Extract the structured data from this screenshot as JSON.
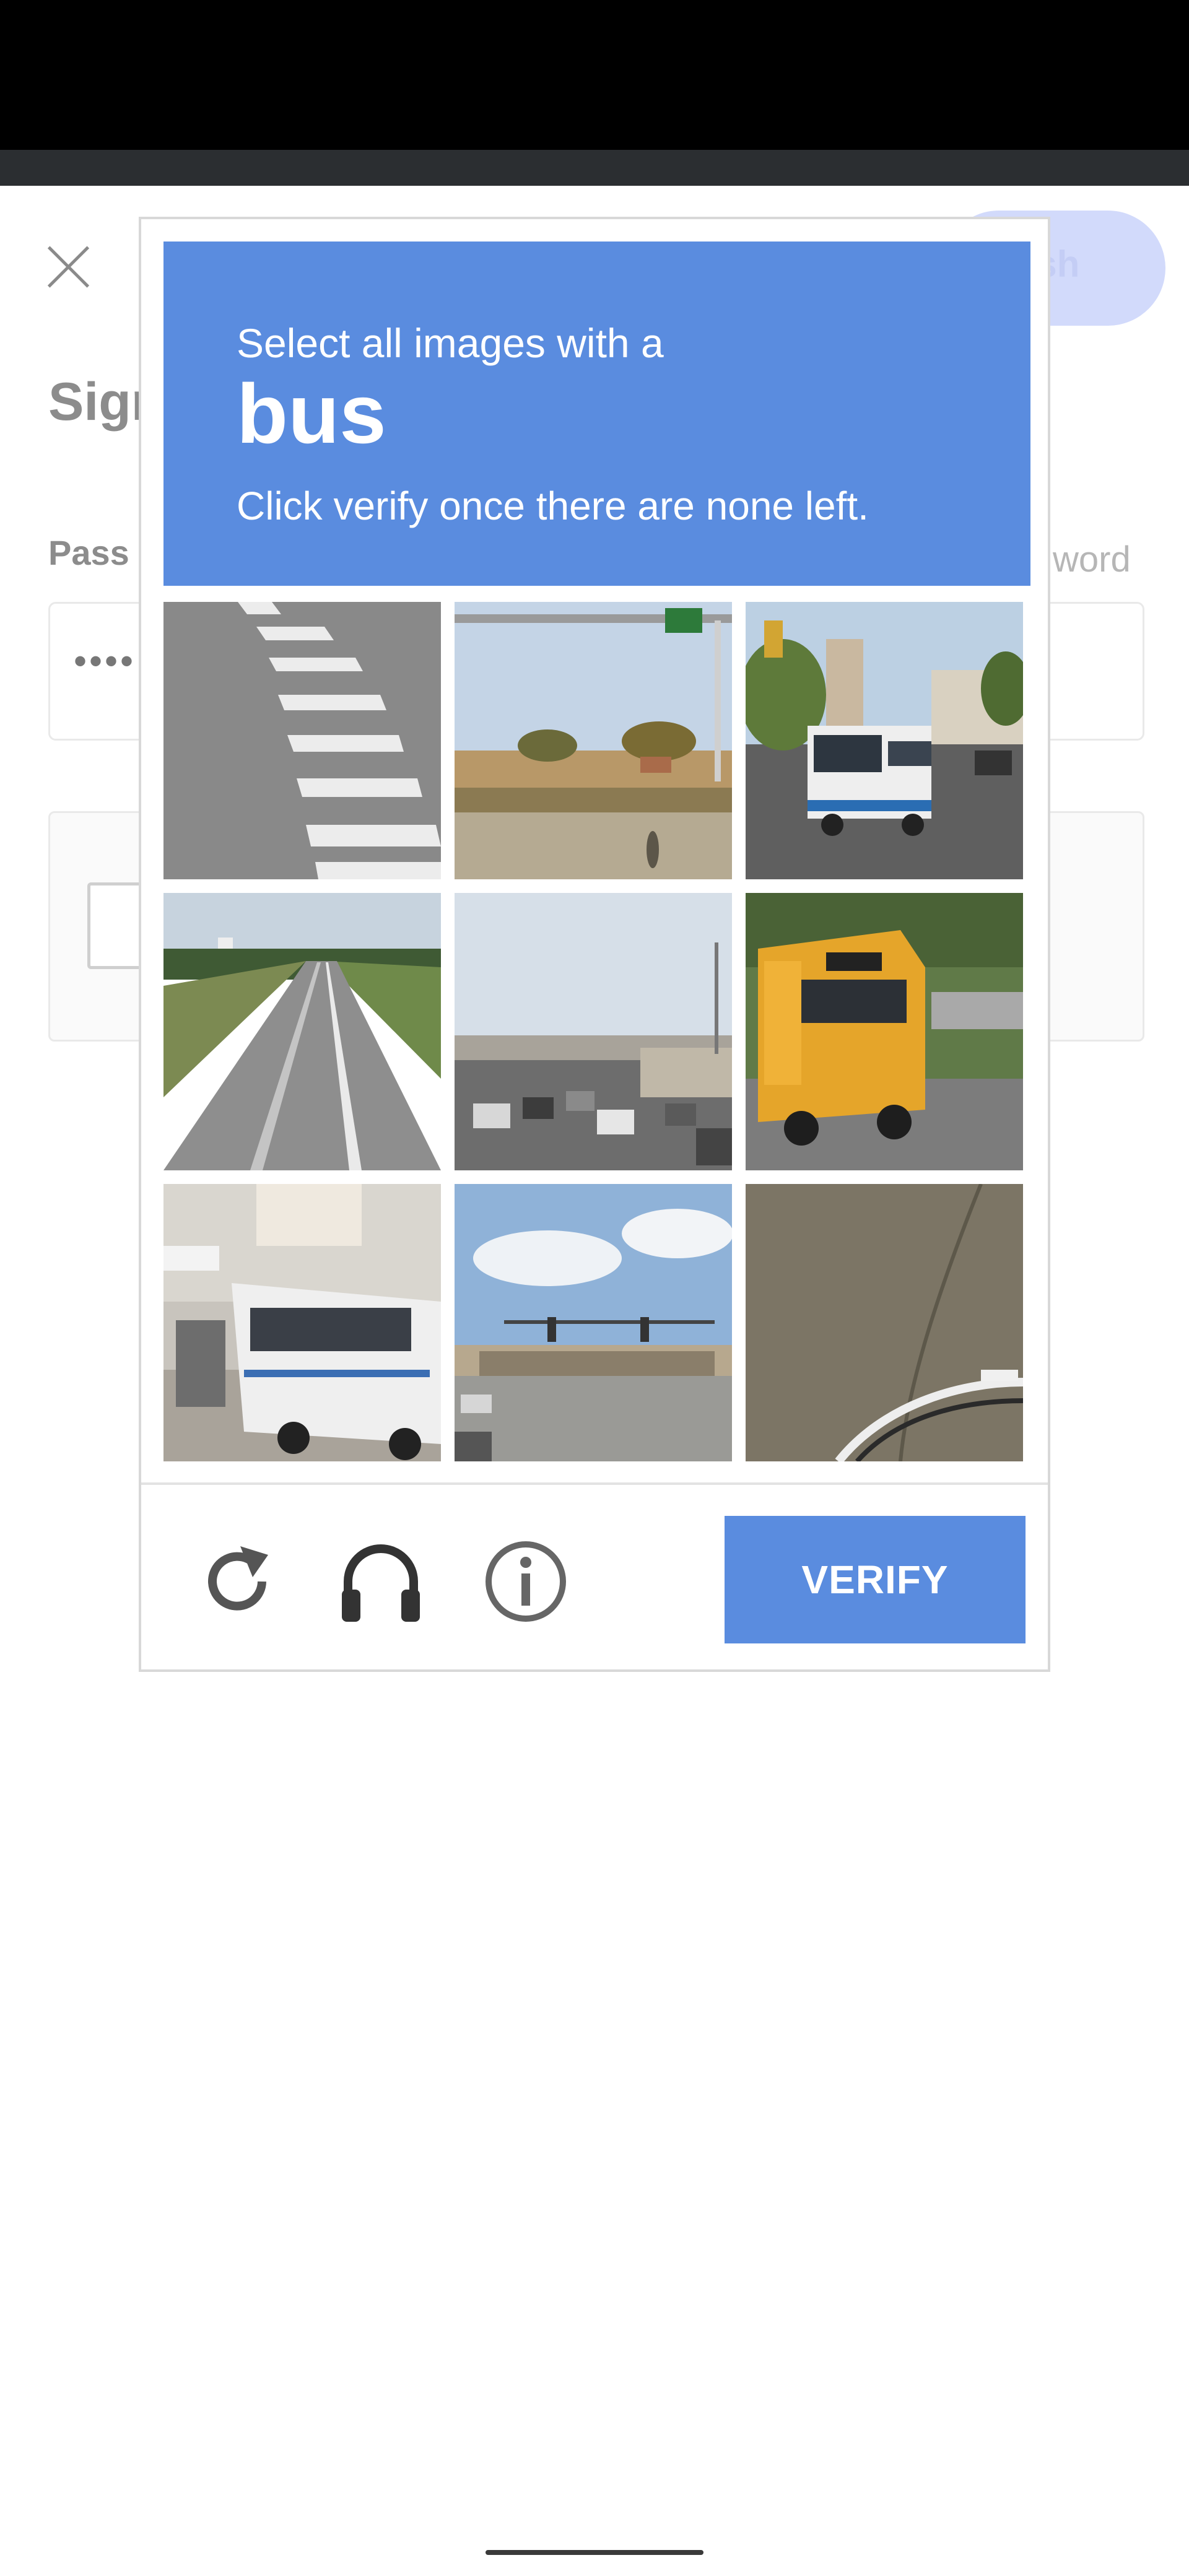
{
  "background_page": {
    "title_partial": "Sign",
    "publish_partial": "lish",
    "password_label_partial": "Pass",
    "forgot_partial": "word",
    "password_mask": "••••"
  },
  "captcha": {
    "instruction_line1": "Select all images with a",
    "target": "bus",
    "instruction_line2": "Click verify once there are none left.",
    "tiles": [
      {
        "scene": "crosswalk road"
      },
      {
        "scene": "overpass sign and grass field"
      },
      {
        "scene": "white city bus on street"
      },
      {
        "scene": "highway lanes"
      },
      {
        "scene": "intersection with cars"
      },
      {
        "scene": "yellow school bus"
      },
      {
        "scene": "white city bus at curb"
      },
      {
        "scene": "intersection with traffic lights"
      },
      {
        "scene": "pavement with bicycle"
      }
    ],
    "icons": {
      "reload": "reload-icon",
      "audio": "headphones-icon",
      "info": "info-icon"
    },
    "verify_label": "VERIFY"
  },
  "colors": {
    "accent": "#5a8cdf",
    "publish_bg": "#d2dafb"
  }
}
